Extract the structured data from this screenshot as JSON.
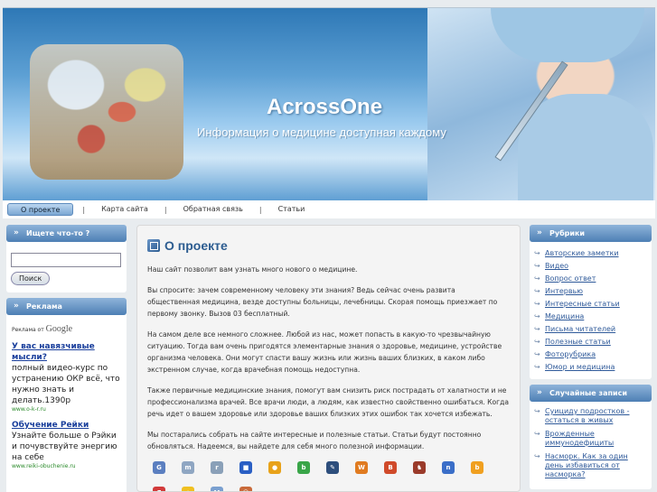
{
  "header": {
    "title": "AcrossOne",
    "description": "Информация о медицине доступная каждому"
  },
  "nav": {
    "items": [
      "О проекте",
      "Карта сайта",
      "Обратная связь",
      "Статьи"
    ],
    "separator": "|"
  },
  "search": {
    "title": "Ищете что-то ?",
    "button": "Поиск",
    "value": ""
  },
  "ads": {
    "title": "Реклама",
    "by": "Реклама от",
    "by_brand": "Google",
    "items": [
      {
        "link": "У вас навязчивые мысли?",
        "text": "полный видео-курс по устранению ОКР всё, что нужно знать и делать.1390р",
        "url": "www.o-k-r.ru"
      },
      {
        "link": "Обучение Рейки",
        "text": "Узнайте больше о Рэйки и почувствуйте энергию на себе",
        "url": "www.reiki-obuchenie.ru"
      }
    ]
  },
  "main": {
    "title": "О проекте",
    "paragraphs": [
      "Наш сайт позволит вам узнать много нового о медицине.",
      "Вы спросите: зачем современному человеку эти знания? Ведь сейчас очень развита общественная медицина, везде доступны больницы, лечебницы. Скорая помощь приезжает по первому звонку. Вызов 03 бесплатный.",
      "На самом деле все немного сложнее. Любой из нас, может попасть в какую-то чрезвычайную ситуацию. Тогда вам очень пригодятся элементарные знания о здоровье, медицине, устройстве организма человека. Они могут спасти вашу жизнь или жизнь ваших близких, в каком либо экстренном случае, когда врачебная помощь недоступна.",
      "Также первичные медицинские знания,  помогут вам снизить риск пострадать от халатности и не профессионализма врачей. Все врачи люди, а людям, как известно свойственно ошибаться. Когда речь идет о вашем здоровье или здоровье ваших близких этих ошибок так хочется избежать.",
      "Мы постарались собрать на сайте интересные и полезные статьи. Статьи будут постоянно обновляться. Надеемся, вы найдете для себя много полезной информации."
    ],
    "social": [
      {
        "icon": "google-bookmark-icon",
        "color": "#5b7fc0",
        "glyph": "G"
      },
      {
        "icon": "memori-icon",
        "color": "#8fa6c2",
        "glyph": "m"
      },
      {
        "icon": "reddit-icon",
        "color": "#8aa0b8",
        "glyph": "r"
      },
      {
        "icon": "delicious-icon",
        "color": "#2a5fc4",
        "glyph": "■"
      },
      {
        "icon": "shell-icon",
        "color": "#e8a21a",
        "glyph": "●"
      },
      {
        "icon": "bobr-icon",
        "color": "#39a548",
        "glyph": "b"
      },
      {
        "icon": "lj-icon",
        "color": "#2d4e7c",
        "glyph": "✎"
      },
      {
        "icon": "mister-wong-icon",
        "color": "#e07b20",
        "glyph": "W"
      },
      {
        "icon": "bookmark-icon",
        "color": "#d04a2a",
        "glyph": "B"
      },
      {
        "icon": "chess-icon",
        "color": "#9a3a2a",
        "glyph": "♞"
      },
      {
        "icon": "news2-icon",
        "color": "#3a6ec8",
        "glyph": "n"
      },
      {
        "icon": "blogger-icon",
        "color": "#f0a020",
        "glyph": "b"
      },
      {
        "icon": "yandex-icon",
        "color": "#d23a3a",
        "glyph": "Я"
      },
      {
        "icon": "favorites-star-icon",
        "color": "#f0c020",
        "glyph": "★"
      },
      {
        "icon": "myspace-icon",
        "color": "#7aa0d0",
        "glyph": "M"
      },
      {
        "icon": "face-icon",
        "color": "#c96a3a",
        "glyph": "☺"
      }
    ]
  },
  "categories": {
    "title": "Рубрики",
    "items": [
      "Авторские заметки",
      "Видео",
      "Вопрос ответ",
      "Интервью",
      "Интересные статьи",
      "Медицина",
      "Письма читателей",
      "Полезные статьи",
      "Фоторубрика",
      "Юмор и медицина"
    ]
  },
  "random": {
    "title": "Случайные записи",
    "items": [
      "Суициду подростков - остаться в живых",
      "Врожденные иммунодефициты",
      "Насморк. Как за один день избавиться от насморка?"
    ]
  },
  "colors": {
    "accent": "#2c5c90",
    "widget_header": "#4d7fb4",
    "link": "#2f5a9a"
  }
}
